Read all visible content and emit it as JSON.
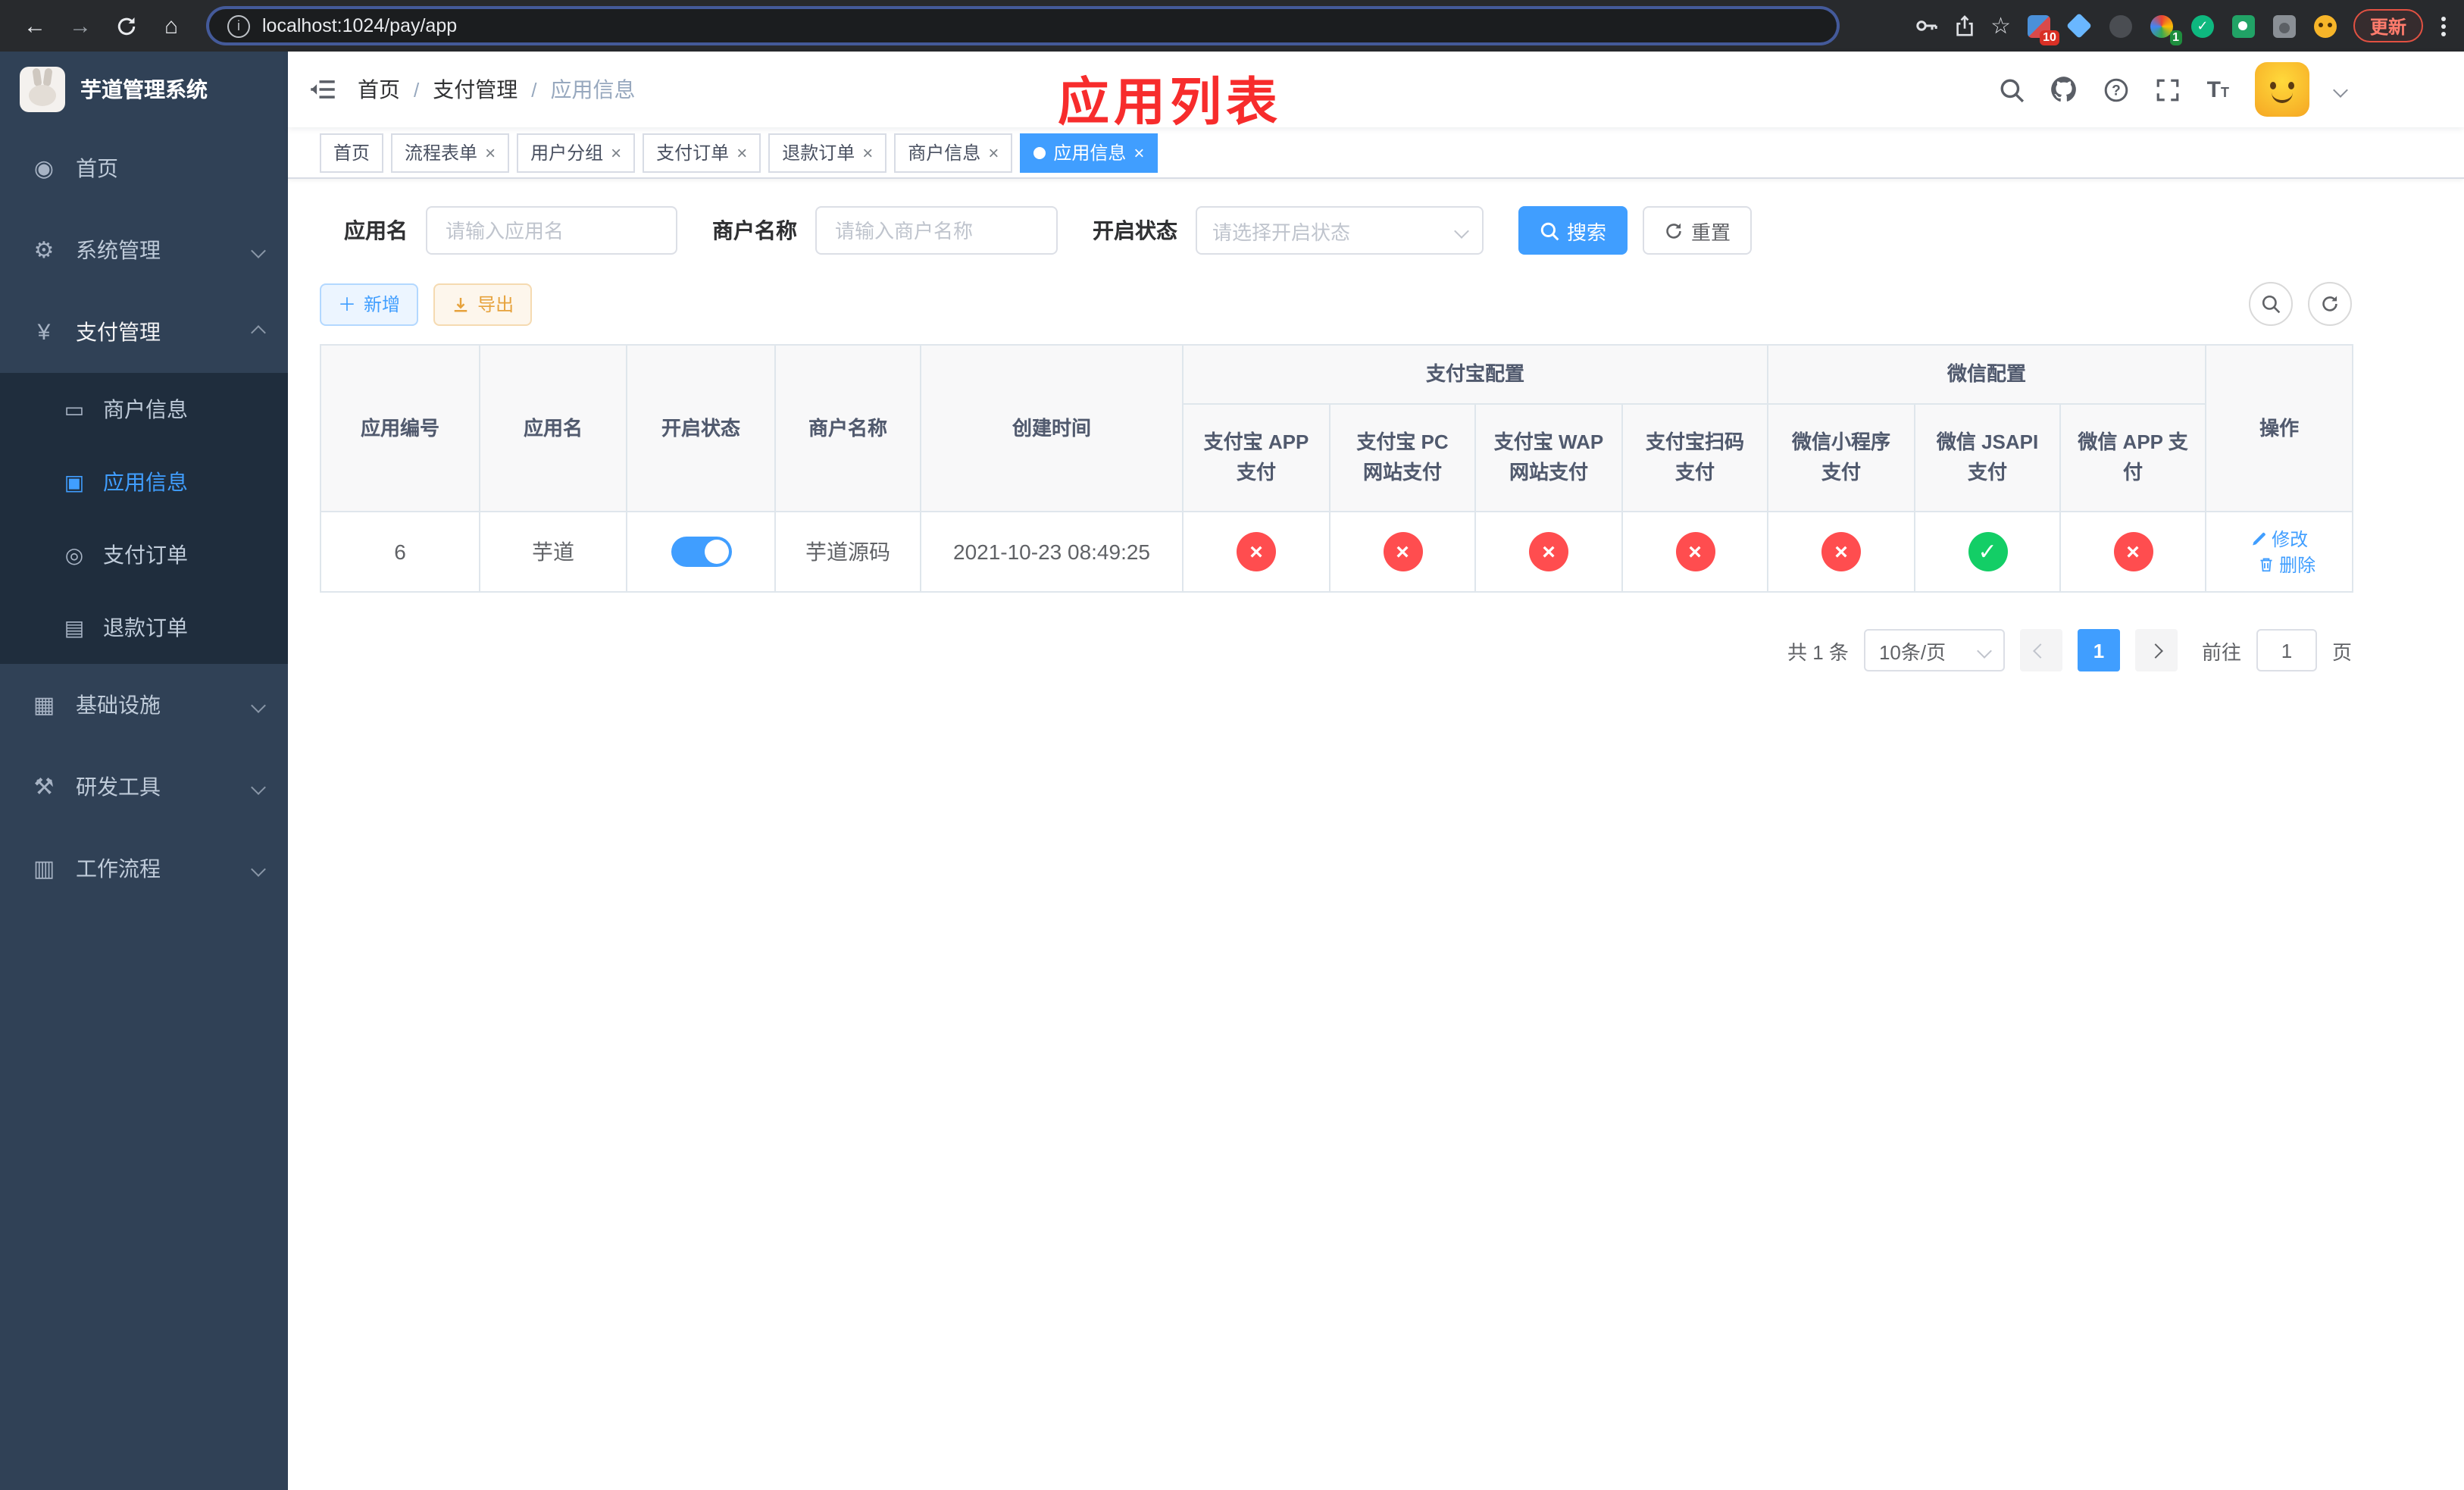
{
  "colors": {
    "accent": "#409eff",
    "danger": "#ff4d4f",
    "success": "#13ce66",
    "warning": "#e6a23c",
    "sidebar_bg": "#304156",
    "sidebar_sub_bg": "#1f2d3d",
    "annotation_red": "#f72c2c"
  },
  "browser": {
    "url": "localhost:1024/pay/app",
    "update_label": "更新",
    "ext_badge_puzzle": "10",
    "ext_badge_circle": "1"
  },
  "sidebar": {
    "title": "芋道管理系统",
    "menu": [
      {
        "label": "首页"
      },
      {
        "label": "系统管理"
      },
      {
        "label": "支付管理"
      },
      {
        "label": "基础设施"
      },
      {
        "label": "研发工具"
      },
      {
        "label": "工作流程"
      }
    ],
    "pay_submenu": [
      {
        "label": "商户信息"
      },
      {
        "label": "应用信息"
      },
      {
        "label": "支付订单"
      },
      {
        "label": "退款订单"
      }
    ]
  },
  "navbar": {
    "breadcrumb": [
      "首页",
      "支付管理",
      "应用信息"
    ],
    "annotation": "应用列表"
  },
  "tabs": [
    {
      "label": "首页",
      "closable": false,
      "active": false
    },
    {
      "label": "流程表单",
      "closable": true,
      "active": false
    },
    {
      "label": "用户分组",
      "closable": true,
      "active": false
    },
    {
      "label": "支付订单",
      "closable": true,
      "active": false
    },
    {
      "label": "退款订单",
      "closable": true,
      "active": false
    },
    {
      "label": "商户信息",
      "closable": true,
      "active": false
    },
    {
      "label": "应用信息",
      "closable": true,
      "active": true
    }
  ],
  "filters": {
    "app_name_label": "应用名",
    "app_name_placeholder": "请输入应用名",
    "merchant_label": "商户名称",
    "merchant_placeholder": "请输入商户名称",
    "status_label": "开启状态",
    "status_placeholder": "请选择开启状态",
    "search_button": "搜索",
    "reset_button": "重置"
  },
  "toolbar": {
    "add_button": "新增",
    "export_button": "导出"
  },
  "table": {
    "group_headers": {
      "alipay": "支付宝配置",
      "wechat": "微信配置"
    },
    "columns": [
      "应用编号",
      "应用名",
      "开启状态",
      "商户名称",
      "创建时间",
      "支付宝 APP 支付",
      "支付宝 PC 网站支付",
      "支付宝 WAP 网站支付",
      "支付宝扫码支付",
      "微信小程序支付",
      "微信 JSAPI 支付",
      "微信 APP 支付",
      "操作"
    ],
    "rows": [
      {
        "id": "6",
        "name": "芋道",
        "enabled": true,
        "merchant": "芋道源码",
        "created_at": "2021-10-23 08:49:25",
        "channels": [
          false,
          false,
          false,
          false,
          false,
          true,
          false
        ],
        "edit_label": "修改",
        "delete_label": "删除"
      }
    ]
  },
  "pagination": {
    "total": "共 1 条",
    "page_size": "10条/页",
    "page": "1",
    "goto_label": "前往",
    "goto_value": "1",
    "page_unit": "页"
  }
}
